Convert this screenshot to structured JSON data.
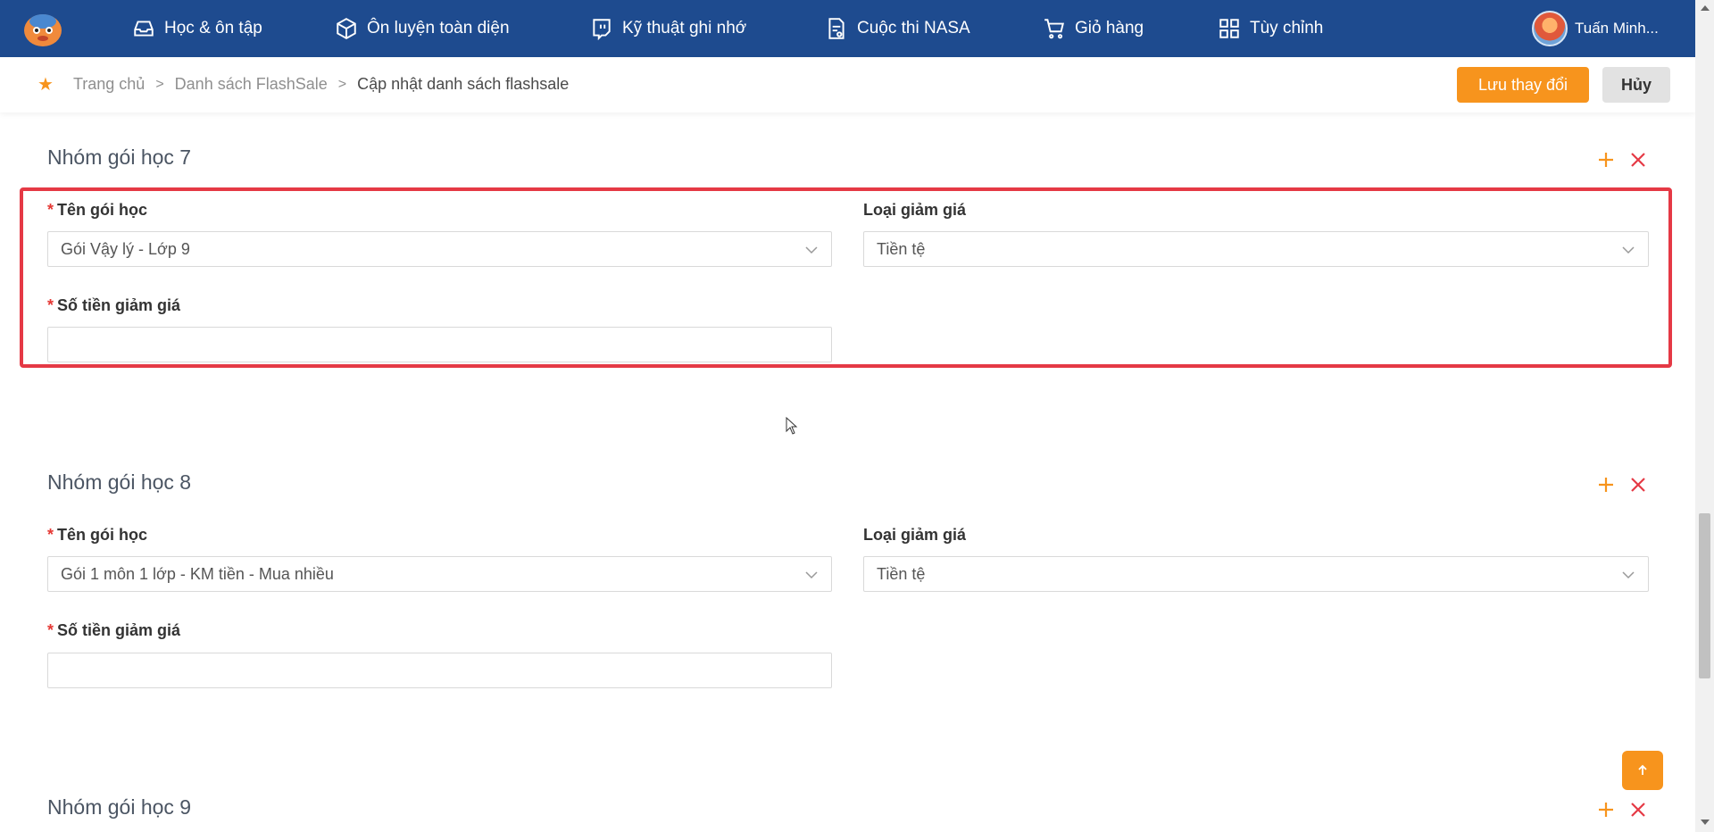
{
  "nav": {
    "items": [
      {
        "label": "Học & ôn tập",
        "icon": "inbox-icon"
      },
      {
        "label": "Ôn luyện toàn diện",
        "icon": "cube-icon"
      },
      {
        "label": "Kỹ thuật ghi nhớ",
        "icon": "twitch-icon"
      },
      {
        "label": "Cuộc thi NASA",
        "icon": "document-icon"
      },
      {
        "label": "Giỏ hàng",
        "icon": "cart-icon"
      },
      {
        "label": "Tùy chỉnh",
        "icon": "grid-icon"
      }
    ],
    "user_name": "Tuấn Minh..."
  },
  "breadcrumb": {
    "home": "Trang chủ",
    "list": "Danh sách FlashSale",
    "current": "Cập nhật danh sách flashsale",
    "separator": ">"
  },
  "actions": {
    "save_label": "Lưu thay đổi",
    "cancel_label": "Hủy"
  },
  "labels": {
    "package_name": "Tên gói học",
    "discount_type": "Loại giảm giá",
    "discount_amount": "Số tiền giảm giá",
    "required_mark": "*"
  },
  "groups": [
    {
      "title": "Nhóm gói học 7",
      "package": "Gói Vậy lý - Lớp 9",
      "discount_type": "Tiền tệ",
      "amount": ""
    },
    {
      "title": "Nhóm gói học 8",
      "package": "Gói 1 môn 1 lớp - KM tiền - Mua nhiều",
      "discount_type": "Tiền tệ",
      "amount": ""
    },
    {
      "title": "Nhóm gói học 9"
    }
  ],
  "colors": {
    "nav_bg": "#1e4b8f",
    "accent": "#f7941d",
    "danger": "#e53945"
  }
}
